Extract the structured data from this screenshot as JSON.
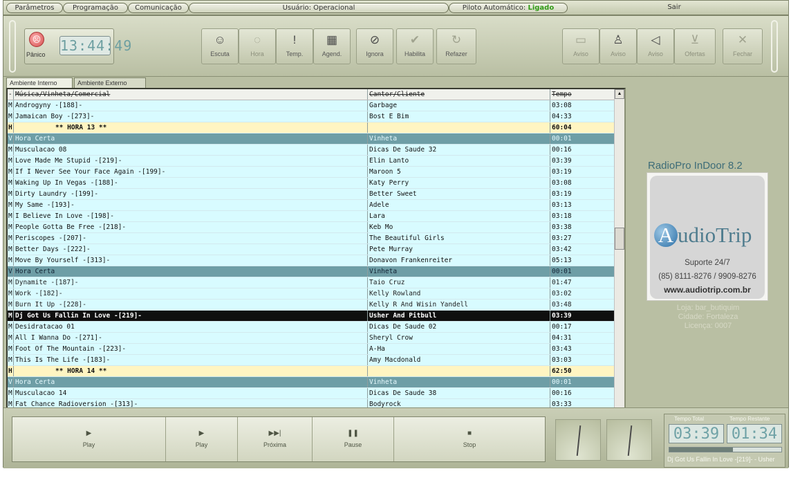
{
  "menu": {
    "parametros": "Parâmetros",
    "programacao": "Programação",
    "comunicacao": "Comunicação",
    "usuario_label": "Usuário:",
    "usuario_value": "Operacional",
    "piloto_label": "Piloto Automático:",
    "piloto_value": "Ligado",
    "sair": "Sair"
  },
  "colors": {
    "accent_green": "#2f9a14",
    "playlist_bg": "#d8fbff",
    "hour_row": "#fff5c2",
    "vinheta_row": "#6e9ea6"
  },
  "toolbar": {
    "panic_label": "Pânico",
    "clock": "13:44:49",
    "buttons": [
      {
        "name": "escuta",
        "label": "Escuta",
        "icon": "face-icon"
      },
      {
        "name": "hora",
        "label": "Hora",
        "icon": "clock-icon"
      },
      {
        "name": "temp",
        "label": "Temp.",
        "icon": "thermometer-icon"
      },
      {
        "name": "agend",
        "label": "Agend.",
        "icon": "calendar-icon"
      },
      {
        "name": "ignora",
        "label": "Ignora",
        "icon": "block-icon"
      },
      {
        "name": "habilita",
        "label": "Habilita",
        "icon": "check-icon"
      },
      {
        "name": "refazer",
        "label": "Refazer",
        "icon": "refresh-icon"
      },
      {
        "name": "aviso-1",
        "label": "Aviso",
        "icon": "printer-icon"
      },
      {
        "name": "aviso-2",
        "label": "Aviso",
        "icon": "person-icon"
      },
      {
        "name": "aviso-3",
        "label": "Aviso",
        "icon": "speaker-icon"
      },
      {
        "name": "ofertas",
        "label": "Ofertas",
        "icon": "cart-icon"
      },
      {
        "name": "fechar",
        "label": "Fechar",
        "icon": "close-icon"
      }
    ]
  },
  "tabs": [
    "Ambiente Interno",
    "Ambiente Externo"
  ],
  "playlist": {
    "headers": [
      "-",
      "Música/Vinheta/Comercial",
      "Cantor/Cliente",
      "Tempo"
    ],
    "rows": [
      {
        "type": "M",
        "title": "Androgyny -[188]-",
        "artist": "Garbage",
        "time": "03:08",
        "state": "normal"
      },
      {
        "type": "M",
        "title": "Jamaican Boy -[273]-",
        "artist": "Bost E Bim",
        "time": "04:33",
        "state": "normal"
      },
      {
        "type": "H",
        "title": "** HORA 13 **",
        "artist": "",
        "time": "60:04",
        "state": "hour"
      },
      {
        "type": "V",
        "title": "Hora Certa",
        "artist": "Vinheta",
        "time": "00:01",
        "state": "vin"
      },
      {
        "type": "M",
        "title": "Musculacao 08",
        "artist": "Dicas De Saude 32",
        "time": "00:16",
        "state": "normal"
      },
      {
        "type": "M",
        "title": "Love Made Me Stupid -[219]-",
        "artist": "Elin Lanto",
        "time": "03:39",
        "state": "normal"
      },
      {
        "type": "M",
        "title": "If I Never See Your Face Again -[199]-",
        "artist": "Maroon 5",
        "time": "03:19",
        "state": "normal"
      },
      {
        "type": "M",
        "title": "Waking Up In Vegas -[188]-",
        "artist": "Katy Perry",
        "time": "03:08",
        "state": "normal"
      },
      {
        "type": "M",
        "title": "Dirty Laundry -[199]-",
        "artist": "Better Sweet",
        "time": "03:19",
        "state": "normal"
      },
      {
        "type": "M",
        "title": "My Same -[193]-",
        "artist": "Adele",
        "time": "03:13",
        "state": "normal"
      },
      {
        "type": "M",
        "title": "I Believe In Love -[198]-",
        "artist": "Lara",
        "time": "03:18",
        "state": "normal"
      },
      {
        "type": "M",
        "title": "People Gotta Be Free -[218]-",
        "artist": "Keb Mo",
        "time": "03:38",
        "state": "normal"
      },
      {
        "type": "M",
        "title": "Periscopes -[207]-",
        "artist": "The Beautiful Girls",
        "time": "03:27",
        "state": "normal"
      },
      {
        "type": "M",
        "title": "Better Days -[222]-",
        "artist": "Pete Murray",
        "time": "03:42",
        "state": "normal"
      },
      {
        "type": "M",
        "title": "Move By Yourself -[313]-",
        "artist": "Donavon Frankenreiter",
        "time": "05:13",
        "state": "normal"
      },
      {
        "type": "V",
        "title": "Hora Certa",
        "artist": "Vinheta",
        "time": "00:01",
        "state": "vin-played"
      },
      {
        "type": "M",
        "title": "Dynamite -[187]-",
        "artist": "Taio Cruz",
        "time": "01:47",
        "state": "played"
      },
      {
        "type": "M",
        "title": "Work -[182]-",
        "artist": "Kelly Rowland",
        "time": "03:02",
        "state": "played"
      },
      {
        "type": "M",
        "title": "Burn It Up -[228]-",
        "artist": "Kelly R And Wisin Yandell",
        "time": "03:48",
        "state": "played"
      },
      {
        "type": "M",
        "title": "Dj Got Us Fallin  In Love -[219]-",
        "artist": "Usher And Pitbull",
        "time": "03:39",
        "state": "current"
      },
      {
        "type": "M",
        "title": "Desidratacao 01",
        "artist": "Dicas De Saude 02",
        "time": "00:17",
        "state": "normal"
      },
      {
        "type": "M",
        "title": "All I Wanna Do -[271]-",
        "artist": "Sheryl Crow",
        "time": "04:31",
        "state": "normal"
      },
      {
        "type": "M",
        "title": "Foot Of The Mountain -[223]-",
        "artist": "A-Ha",
        "time": "03:43",
        "state": "normal"
      },
      {
        "type": "M",
        "title": "This Is The Life -[183]-",
        "artist": "Amy Macdonald",
        "time": "03:03",
        "state": "normal"
      },
      {
        "type": "H",
        "title": "** HORA 14 **",
        "artist": "",
        "time": "62:50",
        "state": "hour"
      },
      {
        "type": "V",
        "title": "Hora Certa",
        "artist": "Vinheta",
        "time": "00:01",
        "state": "vin"
      },
      {
        "type": "M",
        "title": "Musculacao 14",
        "artist": "Dicas De Saude 38",
        "time": "00:16",
        "state": "normal"
      },
      {
        "type": "M",
        "title": "Fat Chance Radioversion -[313]-",
        "artist": "Bodyrock",
        "time": "03:33",
        "state": "normal"
      }
    ]
  },
  "info": {
    "brand": "RadioPro InDoor  8.2",
    "logo_initial": "A",
    "logo_rest": "udioTrip",
    "support_title": "Suporte 24/7",
    "support_phones": "(85) 8111-8276 / 9909-8276",
    "support_web": "www.audiotrip.com.br",
    "loja": "Loja: bar_butiquim",
    "cidade": "Cidade: Fortaleza",
    "licenca": "Licença: 0007"
  },
  "transport": {
    "buttons": [
      {
        "name": "play-1",
        "label": "Play",
        "icon": "play-icon"
      },
      {
        "name": "play-2",
        "label": "Play",
        "icon": "play-icon"
      },
      {
        "name": "next",
        "label": "Próxima",
        "icon": "next-icon"
      },
      {
        "name": "pause",
        "label": "Pause",
        "icon": "pause-icon"
      },
      {
        "name": "stop",
        "label": "Stop",
        "icon": "stop-icon"
      }
    ]
  },
  "timer": {
    "total_label": "Tempo Total",
    "remaining_label": "Tempo Restante",
    "total": "03:39",
    "remaining": "01:34",
    "progress": 0.57,
    "now_playing": "Dj Got Us Fallin  In Love -[219]- - Usher"
  }
}
